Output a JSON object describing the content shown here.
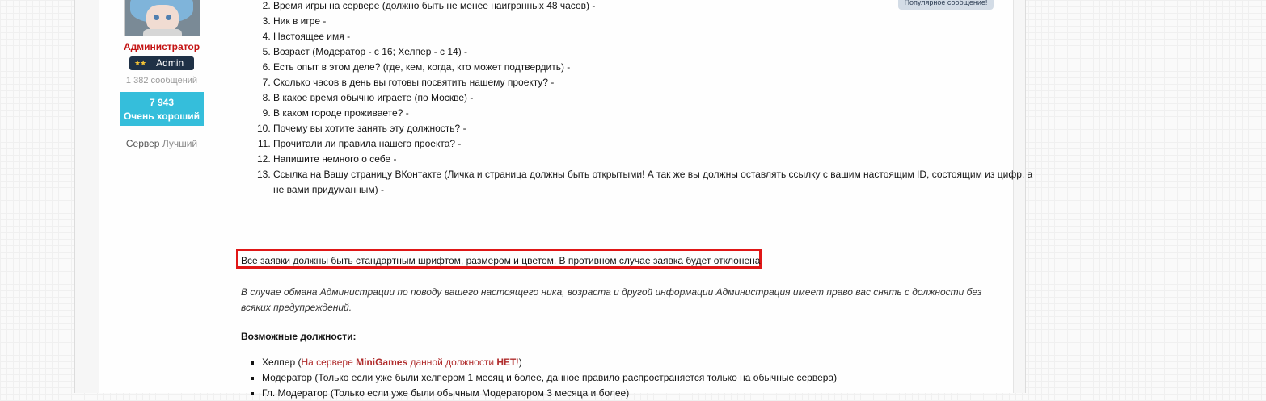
{
  "user": {
    "name": "Администратор",
    "banner_stars": "★★",
    "banner_label": "Admin",
    "messages": "1 382 сообщений",
    "rating_value": "7 943",
    "rating_label": "Очень хороший",
    "server_label": "Сервер",
    "server_value": "Лучший"
  },
  "popular_badge": "Популярное сообщение!",
  "questions": [
    {
      "num": 2,
      "before": "Время игры на сервере (",
      "underlined": "должно быть не менее наигранных 48 часов",
      "after": ") -"
    },
    {
      "num": 3,
      "text": "Ник в игре -"
    },
    {
      "num": 4,
      "text": "Настоящее имя -"
    },
    {
      "num": 5,
      "text": "Возраст  (Модератор - с 16; Хелпер - с 14) -"
    },
    {
      "num": 6,
      "text": "Есть опыт в этом деле? (где, кем, когда, кто может подтвердить) -"
    },
    {
      "num": 7,
      "text": "Сколько часов в день вы готовы посвятить нашему проекту? -"
    },
    {
      "num": 8,
      "text": "В какое время обычно играете (по Москве) -"
    },
    {
      "num": 9,
      "text": "В каком городе проживаете? -"
    },
    {
      "num": 10,
      "text": "Почему вы хотите занять эту должность? -"
    },
    {
      "num": 11,
      "text": "Прочитали ли правила нашего проекта? -"
    },
    {
      "num": 12,
      "text": "Напишите немного о себе -"
    },
    {
      "num": 13,
      "text": "Ссылка на Вашу страницу ВКонтакте (Личка и страница должны быть открытыми! А так же вы должны оставлять ссылку с вашим настоящим ID, состоящим из цифр, а не вами придуманным) -"
    }
  ],
  "warning": "Все заявки должны быть стандартным шрифтом, размером и цветом. В противном случае заявка будет отклонена",
  "fraud_note": "В случае обмана Администрации по поводу вашего настоящего ника, возраста и другой информации Администрация имеет право вас снять с должности без всяких предупреждений.",
  "possible_title": "Возможные должности:",
  "roles": {
    "helper_name": "Хелпер (",
    "helper_note_1": "На сервере ",
    "helper_note_bold1": "MiniGames",
    "helper_note_2": " данной должности ",
    "helper_note_bold2": "НЕТ",
    "helper_note_3": "!",
    "helper_close": ")",
    "moderator": "Модератор (Только если уже были хелпером 1 месяц и более, данное правило распространяется только на обычные сервера)",
    "chief_moderator": "Гл. Модератор (Только если уже были обычным Модератором 3 месяца и более)"
  },
  "colors": {
    "admin_red": "#c41414",
    "rating_bg": "#35bedb",
    "banner_bg": "#1f3146",
    "highlight_border": "#e01717"
  }
}
